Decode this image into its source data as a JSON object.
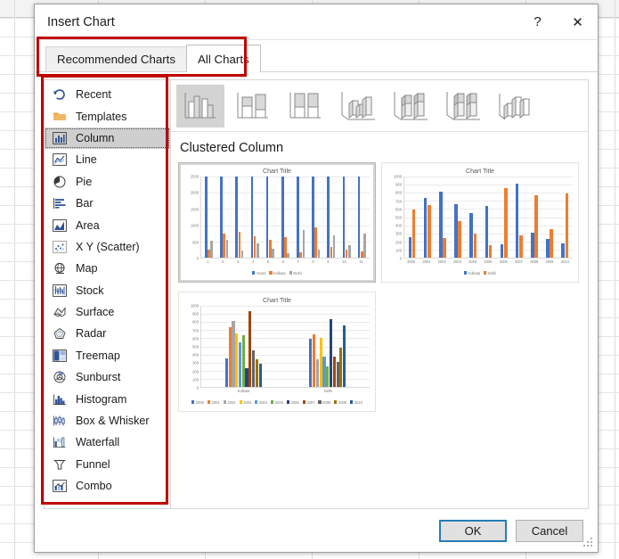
{
  "dialog": {
    "title": "Insert Chart",
    "help_label": "?",
    "close_label": "✕"
  },
  "tabs": [
    {
      "label": "Recommended Charts",
      "active": false
    },
    {
      "label": "All Charts",
      "active": true
    }
  ],
  "sidebar": {
    "items": [
      {
        "label": "Recent",
        "icon": "recent-icon",
        "selected": false
      },
      {
        "label": "Templates",
        "icon": "templates-folder-icon",
        "selected": false
      },
      {
        "label": "Column",
        "icon": "column-chart-icon",
        "selected": true
      },
      {
        "label": "Line",
        "icon": "line-chart-icon",
        "selected": false
      },
      {
        "label": "Pie",
        "icon": "pie-chart-icon",
        "selected": false
      },
      {
        "label": "Bar",
        "icon": "bar-chart-icon",
        "selected": false
      },
      {
        "label": "Area",
        "icon": "area-chart-icon",
        "selected": false
      },
      {
        "label": "X Y (Scatter)",
        "icon": "scatter-chart-icon",
        "selected": false
      },
      {
        "label": "Map",
        "icon": "map-chart-icon",
        "selected": false
      },
      {
        "label": "Stock",
        "icon": "stock-chart-icon",
        "selected": false
      },
      {
        "label": "Surface",
        "icon": "surface-chart-icon",
        "selected": false
      },
      {
        "label": "Radar",
        "icon": "radar-chart-icon",
        "selected": false
      },
      {
        "label": "Treemap",
        "icon": "treemap-chart-icon",
        "selected": false
      },
      {
        "label": "Sunburst",
        "icon": "sunburst-chart-icon",
        "selected": false
      },
      {
        "label": "Histogram",
        "icon": "histogram-chart-icon",
        "selected": false
      },
      {
        "label": "Box & Whisker",
        "icon": "box-whisker-chart-icon",
        "selected": false
      },
      {
        "label": "Waterfall",
        "icon": "waterfall-chart-icon",
        "selected": false
      },
      {
        "label": "Funnel",
        "icon": "funnel-chart-icon",
        "selected": false
      },
      {
        "label": "Combo",
        "icon": "combo-chart-icon",
        "selected": false
      }
    ]
  },
  "subtypes": [
    {
      "name": "clustered-column-subtype",
      "selected": true
    },
    {
      "name": "stacked-column-subtype",
      "selected": false
    },
    {
      "name": "100-percent-stacked-column-subtype",
      "selected": false
    },
    {
      "name": "3d-clustered-column-subtype",
      "selected": false
    },
    {
      "name": "3d-stacked-column-subtype",
      "selected": false
    },
    {
      "name": "3d-100-percent-stacked-column-subtype",
      "selected": false
    },
    {
      "name": "3d-column-subtype",
      "selected": false
    }
  ],
  "subtype_name": "Clustered Column",
  "footer": {
    "ok_label": "OK",
    "cancel_label": "Cancel"
  },
  "colors": {
    "series_blue": "#4472c4",
    "series_orange": "#ed7d31",
    "series_gray": "#a5a5a5",
    "series_yellow": "#ffc000",
    "series_lightblue": "#5b9bd5",
    "series_green": "#70ad47",
    "series_darkblue": "#264478",
    "series_darkorange": "#9e480e",
    "series_darkgray": "#636363",
    "series_darkyellow": "#997300",
    "series_navy": "#255e91",
    "annotation_red": "#c00000",
    "accent_blue": "#2a7cb5",
    "selection_gray": "#cfcfcf"
  },
  "chart_data": [
    {
      "id": "preview-1",
      "type": "bar",
      "title": "Chart Title",
      "selected": true,
      "xlabel": "",
      "ylabel": "",
      "ylim": [
        0,
        2500
      ],
      "yticks": [
        0,
        500,
        1000,
        1500,
        2000,
        2500
      ],
      "grid": true,
      "legend_position": "bottom",
      "categories": [
        "1",
        "2",
        "3",
        "4",
        "5",
        "6",
        "7",
        "8",
        "9",
        "10",
        "11"
      ],
      "series": [
        {
          "name": "Years",
          "color": "#4472c4",
          "values": [
            2500,
            2500,
            2500,
            2500,
            2500,
            2500,
            2500,
            2500,
            2500,
            2500,
            2500
          ]
        },
        {
          "name": "Kolkata",
          "color": "#ed7d31",
          "values": [
            250,
            740,
            810,
            660,
            560,
            640,
            170,
            930,
            320,
            240,
            190
          ]
        },
        {
          "name": "Delhi",
          "color": "#a5a5a5",
          "values": [
            520,
            560,
            220,
            440,
            270,
            150,
            840,
            260,
            690,
            380,
            740
          ]
        }
      ]
    },
    {
      "id": "preview-2",
      "type": "bar",
      "title": "Chart Title",
      "selected": false,
      "xlabel": "",
      "ylabel": "",
      "ylim": [
        0,
        1000
      ],
      "yticks": [
        0,
        100,
        200,
        300,
        400,
        500,
        600,
        700,
        800,
        900,
        1000
      ],
      "grid": true,
      "legend_position": "bottom",
      "categories": [
        "2000",
        "2001",
        "2002",
        "2003",
        "2004",
        "2005",
        "2006",
        "2007",
        "2008",
        "2009",
        "2010"
      ],
      "series": [
        {
          "name": "Kolkata",
          "color": "#4472c4",
          "values": [
            250,
            740,
            810,
            660,
            550,
            640,
            160,
            910,
            310,
            230,
            180
          ]
        },
        {
          "name": "Delhi",
          "color": "#ed7d31",
          "values": [
            590,
            650,
            240,
            450,
            300,
            150,
            860,
            270,
            770,
            350,
            790
          ]
        }
      ]
    },
    {
      "id": "preview-3",
      "type": "bar",
      "title": "Chart Title",
      "selected": false,
      "xlabel": "",
      "ylabel": "",
      "ylim": [
        0,
        1000
      ],
      "yticks": [
        0,
        100,
        200,
        300,
        400,
        500,
        600,
        700,
        800,
        900,
        1000
      ],
      "grid": true,
      "legend_position": "bottom",
      "categories": [
        "Kolkata",
        "Delhi"
      ],
      "series": [
        {
          "name": "2000",
          "color": "#4472c4",
          "values": [
            350,
            590
          ]
        },
        {
          "name": "2001",
          "color": "#ed7d31",
          "values": [
            740,
            650
          ]
        },
        {
          "name": "2002",
          "color": "#a5a5a5",
          "values": [
            810,
            340
          ]
        },
        {
          "name": "2003",
          "color": "#ffc000",
          "values": [
            660,
            610
          ]
        },
        {
          "name": "2004",
          "color": "#5b9bd5",
          "values": [
            550,
            370
          ]
        },
        {
          "name": "2005",
          "color": "#70ad47",
          "values": [
            640,
            250
          ]
        },
        {
          "name": "2006",
          "color": "#264478",
          "values": [
            230,
            840
          ]
        },
        {
          "name": "2007",
          "color": "#9e480e",
          "values": [
            930,
            370
          ]
        },
        {
          "name": "2008",
          "color": "#636363",
          "values": [
            450,
            310
          ]
        },
        {
          "name": "2009",
          "color": "#997300",
          "values": [
            340,
            480
          ]
        },
        {
          "name": "2010",
          "color": "#255e91",
          "values": [
            290,
            760
          ]
        }
      ]
    }
  ],
  "annotations": [
    {
      "name": "tabs-highlight"
    },
    {
      "name": "sidebar-highlight"
    }
  ]
}
